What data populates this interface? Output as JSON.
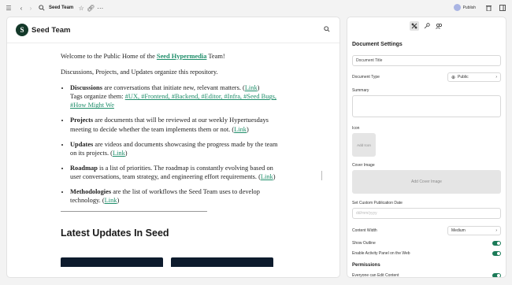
{
  "topbar": {
    "menu_icon": "hamburger-icon",
    "doc_title": "Seed Team",
    "publish_label": "Publish"
  },
  "site": {
    "logo_letter": "S",
    "name": "Seed Team"
  },
  "document": {
    "intro_before": "Welcome to the Public Home of the ",
    "intro_link": "Seed Hypermedia",
    "intro_after": " Team!",
    "subintro": "Discussions, Projects, and Updates organize this repository.",
    "items": [
      {
        "term": "Discussions",
        "text": " are conversations that initiate new, relevant matters. (",
        "link": "Link",
        "after": ")"
      },
      {
        "term": "Projects",
        "text": " are documents that will be reviewed at our weekly Hypertuesdays meeting to decide whether the team implements them or not. (",
        "link": "Link",
        "after": ")"
      },
      {
        "term": "Updates",
        "text": " are videos and documents showcasing the progress made by the team on its projects. (",
        "link": "Link",
        "after": ")"
      },
      {
        "term": "Roadmap",
        "text": " is a list of priorities. The roadmap is constantly evolving based on user conversations, team strategy, and engineering effort requirements. (",
        "link": "Link",
        "after": ")"
      },
      {
        "term": "Methodologies",
        "text": " are the list of workflows the Seed Team uses to develop technology. (",
        "link": "Link",
        "after": ")"
      }
    ],
    "tags_prefix": "Tags organize them: ",
    "tags": "#UX, #Frontend, #Backend, #Editor, #Infra, #Seed Bugs, #How Might We",
    "latest_heading": "Latest Updates In Seed"
  },
  "panel": {
    "section_title": "Document Settings",
    "title_placeholder": "Document Title",
    "doc_type_label": "Document Type",
    "doc_type_value": "Public",
    "summary_label": "Summary",
    "icon_label": "Icon",
    "add_icon": "Add Icon",
    "cover_label": "Cover Image",
    "add_cover": "Add Cover Image",
    "custom_date_label": "Set Custom Publication Date",
    "date_placeholder": "dd/mm/yyyy",
    "content_width_label": "Content Width",
    "content_width_value": "Medium",
    "show_outline_label": "Show Outline",
    "show_outline": true,
    "activity_label": "Enable Activity Panel on the Web",
    "activity": true,
    "permissions_title": "Permissions",
    "everyone_edit_label": "Everyone can Edit Content",
    "everyone_edit": true
  },
  "colors": {
    "accent": "#1f8e6a",
    "toggle_on": "#1a7a57",
    "logo_bg": "#14392a"
  }
}
